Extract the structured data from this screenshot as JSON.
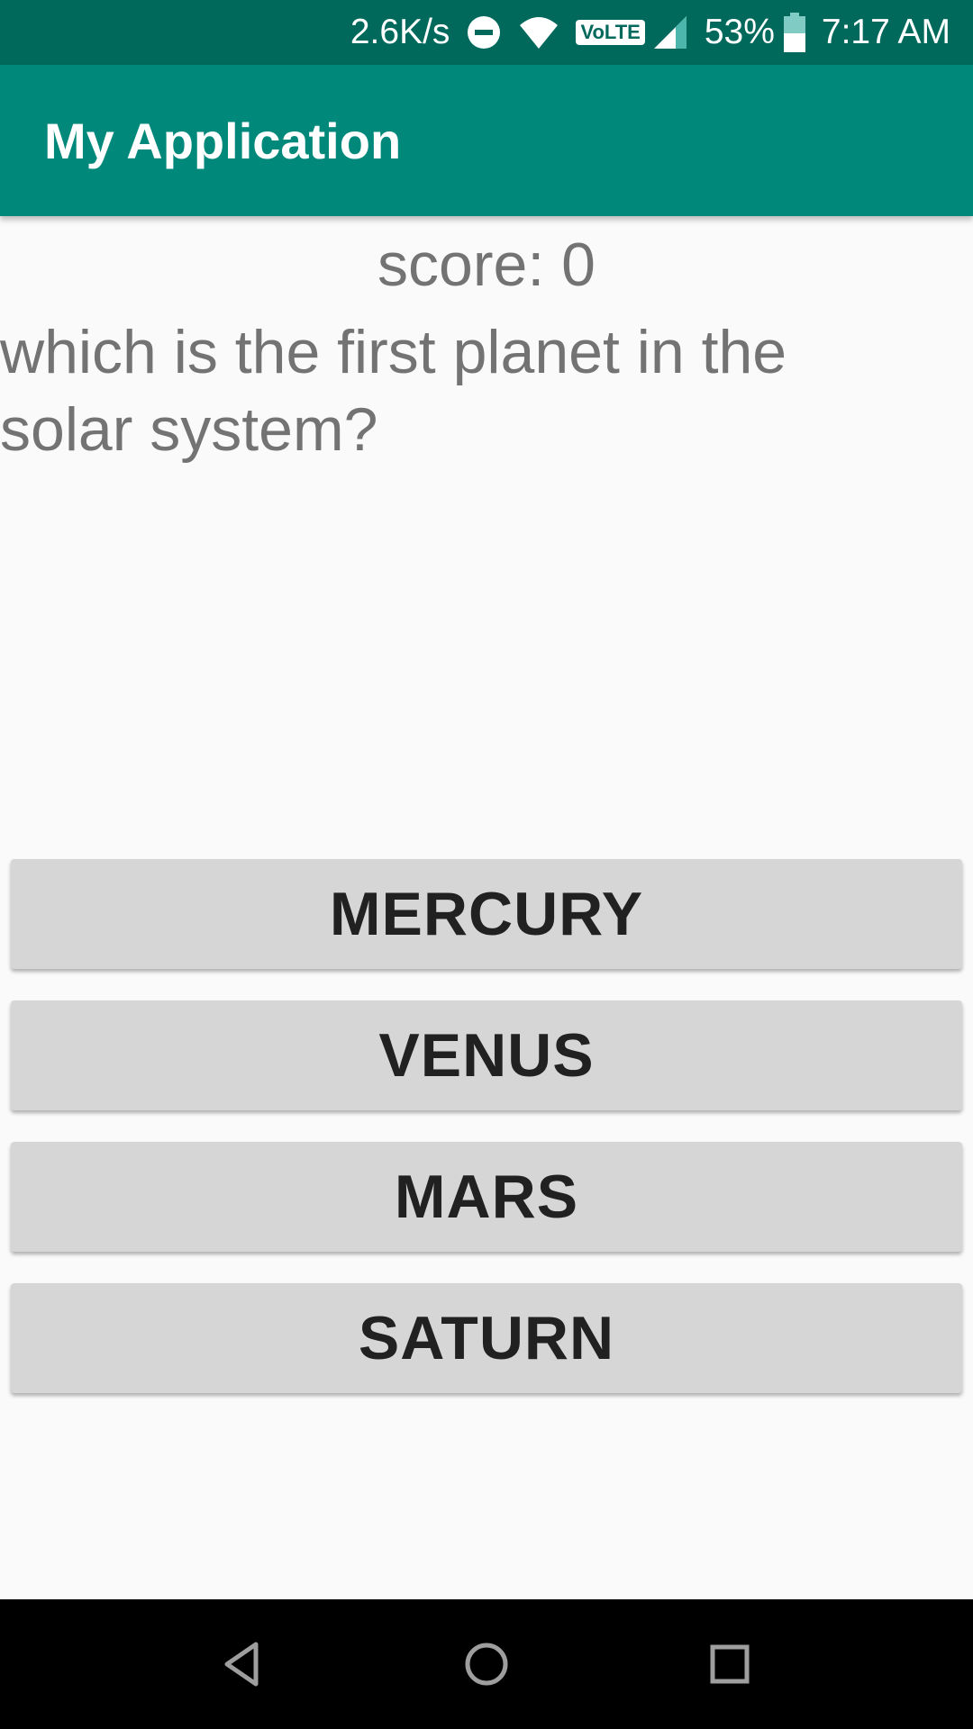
{
  "status_bar": {
    "net_speed": "2.6K/s",
    "volte": "VoLTE",
    "battery": "53%",
    "time": "7:17 AM"
  },
  "app_bar": {
    "title": "My Application"
  },
  "quiz": {
    "score": "score: 0",
    "question": "which is the first planet in the solar system?",
    "answers": [
      "MERCURY",
      "VENUS",
      "MARS",
      "SATURN"
    ]
  },
  "icons": {
    "dnd": "do-not-disturb-icon",
    "wifi": "wifi-icon",
    "signal": "cell-signal-icon",
    "battery": "battery-icon",
    "back": "back-icon",
    "home": "home-icon",
    "recents": "recents-icon"
  },
  "colors": {
    "status_bar": "#00695c",
    "app_bar": "#00897b",
    "button": "#d6d6d6"
  }
}
